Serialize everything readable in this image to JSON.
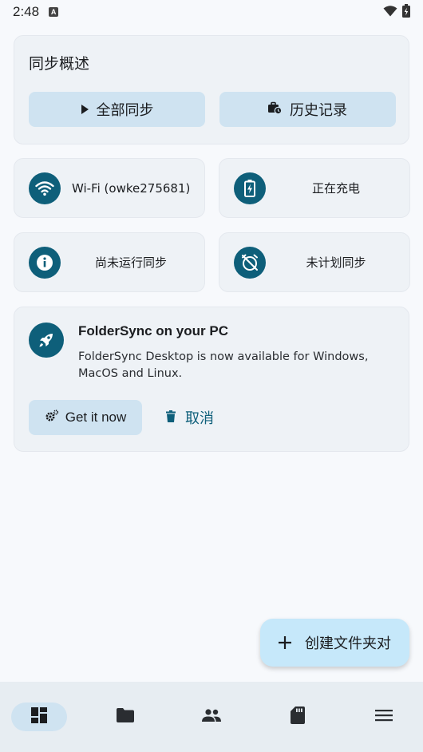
{
  "status_bar": {
    "time": "2:48",
    "badge_letter": "A"
  },
  "overview": {
    "title": "同步概述",
    "sync_all_label": "全部同步",
    "history_label": "历史记录"
  },
  "tiles": {
    "wifi": "Wi-Fi (owke275681)",
    "charging": "正在充电",
    "not_run": "尚未运行同步",
    "not_scheduled": "未计划同步"
  },
  "promo": {
    "title": "FolderSync on your PC",
    "description": "FolderSync Desktop is now available for Windows, MacOS and Linux.",
    "get_label": "Get it now",
    "cancel_label": "取消"
  },
  "fab": {
    "label": "创建文件夹对"
  },
  "bottom_nav": {
    "active": "dashboard",
    "items": [
      "dashboard-icon",
      "folder-icon",
      "accounts-icon",
      "sd-card-icon",
      "menu-icon"
    ]
  },
  "colors": {
    "accent": "#0e5f7a",
    "button_bg": "#cfe3f1",
    "fab_bg": "#c6e8fa",
    "card_bg": "#eef2f6"
  }
}
